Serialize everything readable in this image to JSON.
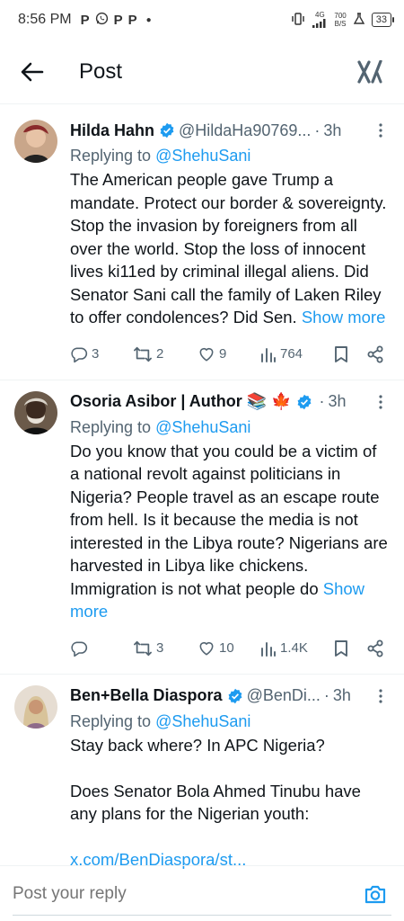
{
  "status_bar": {
    "time": "8:56 PM",
    "apps": [
      "P",
      "P",
      "P"
    ],
    "network": "4G",
    "speed_value": "700",
    "speed_unit": "B/S",
    "battery": "33"
  },
  "header": {
    "title": "Post",
    "back_icon": "arrow-left-icon",
    "grok_icon": "grok-icon"
  },
  "colors": {
    "accent": "#1d9bf0",
    "secondary_text": "#536471",
    "divider": "#eff3f4"
  },
  "replies": [
    {
      "author": "Hilda Hahn",
      "handle": "@HildaHa90769...",
      "time": "3h",
      "replying_prefix": "Replying to",
      "replying_to": "@ShehuSani",
      "text": "The American people gave Trump a mandate. Protect our border & sovereignty. Stop the invasion by foreigners from all over the world. Stop the loss of innocent lives ki11ed by criminal illegal aliens. Did Senator Sani call the family of Laken Riley to offer condolences? Did Sen.",
      "show_more": "Show more",
      "replies_count": "3",
      "reposts_count": "2",
      "likes_count": "9",
      "views_count": "764"
    },
    {
      "author": "Osoria Asibor | Author",
      "author_emoji": "📚 🍁",
      "handle": "",
      "time": "3h",
      "replying_prefix": "Replying to",
      "replying_to": "@ShehuSani",
      "text": "Do you know that you could be a victim of a national revolt against politicians in Nigeria? People travel as an escape route from hell. Is it because the media is not interested in the Libya route? Nigerians are harvested in Libya like chickens. Immigration is not what people do",
      "show_more": "Show more",
      "replies_count": "",
      "reposts_count": "3",
      "likes_count": "10",
      "views_count": "1.4K"
    },
    {
      "author": "Ben+Bella Diaspora",
      "handle": "@BenDi...",
      "time": "3h",
      "replying_prefix": "Replying to",
      "replying_to": "@ShehuSani",
      "text_para1": "Stay back where? In APC Nigeria?",
      "text_para2": "Does Senator Bola Ahmed Tinubu have any plans for the Nigerian youth:",
      "link": "x.com/BenDiaspora/st..."
    }
  ],
  "compose": {
    "placeholder": "Post your reply",
    "camera_icon": "camera-icon"
  }
}
